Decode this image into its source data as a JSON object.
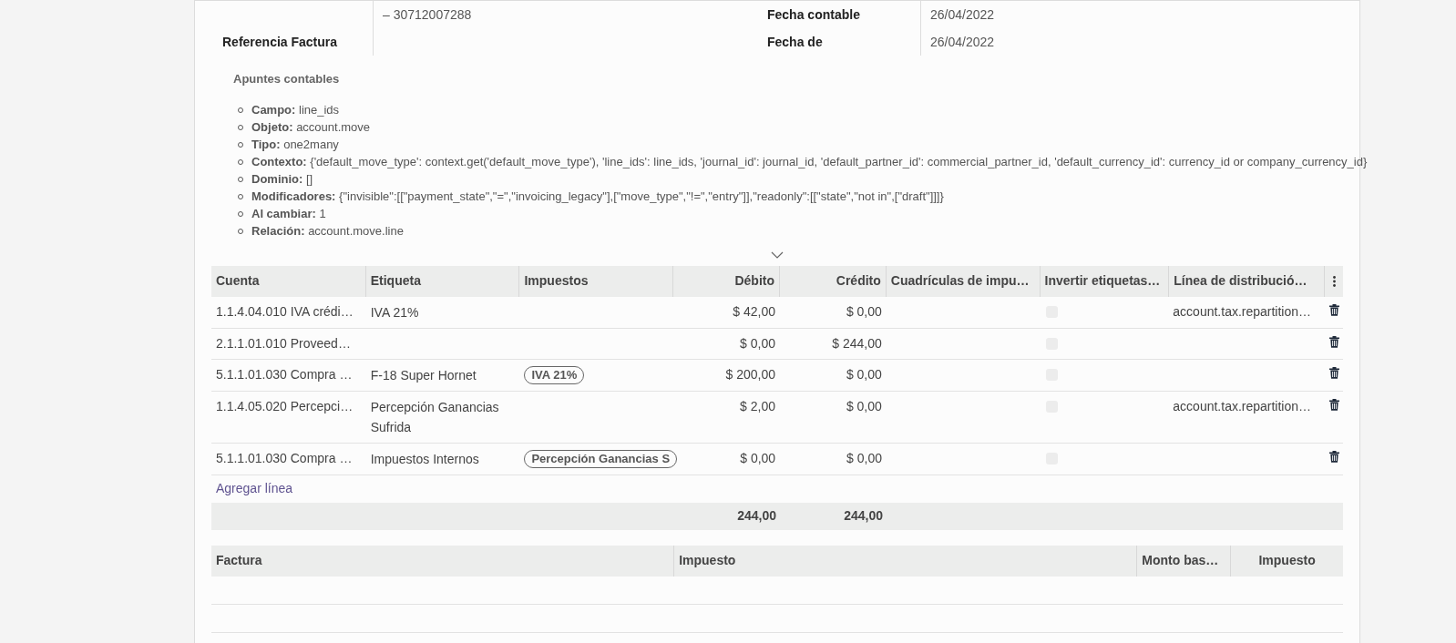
{
  "form": {
    "left": [
      {
        "value": "– 30712007288"
      },
      {
        "label": "Referencia Factura"
      }
    ],
    "right": [
      {
        "label": "Fecha contable",
        "value": "26/04/2022"
      },
      {
        "label": "Fecha de",
        "value": "26/04/2022"
      }
    ]
  },
  "tooltip": {
    "title": "Apuntes contables",
    "items": [
      {
        "label": "Campo:",
        "value": "line_ids"
      },
      {
        "label": "Objeto:",
        "value": "account.move"
      },
      {
        "label": "Tipo:",
        "value": "one2many"
      },
      {
        "label": "Contexto:",
        "value": "{'default_move_type': context.get('default_move_type'), 'line_ids': line_ids, 'journal_id': journal_id, 'default_partner_id': commercial_partner_id, 'default_currency_id': currency_id or company_currency_id}"
      },
      {
        "label": "Dominio:",
        "value": "[]"
      },
      {
        "label": "Modificadores:",
        "value": "{\"invisible\":[[\"payment_state\",\"=\",\"invoicing_legacy\"],[\"move_type\",\"!=\",\"entry\"]],\"readonly\":[[\"state\",\"not in\",[\"draft\"]]]}"
      },
      {
        "label": "Al cambiar:",
        "value": "1"
      },
      {
        "label": "Relación:",
        "value": "account.move.line"
      }
    ]
  },
  "lines_table": {
    "columns": [
      "Cuenta",
      "Etiqueta",
      "Impuestos",
      "Débito",
      "Crédito",
      "Cuadrículas de impu…",
      "Invertir etiquetas…",
      "Línea de distribució…"
    ],
    "rows": [
      {
        "account": "1.1.4.04.010 IVA crédi…",
        "label": "IVA 21%",
        "taxes": [],
        "debit": "$ 42,00",
        "credit": "$ 0,00",
        "checked": false,
        "distribution": "account.tax.repartition…"
      },
      {
        "account": "2.1.1.01.010 Proveed…",
        "label": "",
        "taxes": [],
        "debit": "$ 0,00",
        "credit": "$ 244,00",
        "checked": false,
        "distribution": ""
      },
      {
        "account": "5.1.1.01.030 Compra …",
        "label": "F-18 Super Hornet",
        "taxes": [
          "IVA 21%"
        ],
        "debit": "$ 200,00",
        "credit": "$ 0,00",
        "checked": false,
        "distribution": ""
      },
      {
        "account": "1.1.4.05.020 Percepci…",
        "label": "Percepción Ganancias Sufrida",
        "taxes": [],
        "debit": "$ 2,00",
        "credit": "$ 0,00",
        "checked": false,
        "distribution": "account.tax.repartition…"
      },
      {
        "account": "5.1.1.01.030 Compra …",
        "label": "Impuestos Internos",
        "taxes": [
          "Percepción Ganancias S"
        ],
        "debit": "$ 0,00",
        "credit": "$ 0,00",
        "checked": false,
        "distribution": ""
      }
    ],
    "add_line": "Agregar línea",
    "totals": {
      "debit": "244,00",
      "credit": "244,00"
    }
  },
  "tax_table": {
    "columns": [
      "Factura",
      "Impuesto",
      "Monto bas…",
      "Impuesto"
    ]
  }
}
